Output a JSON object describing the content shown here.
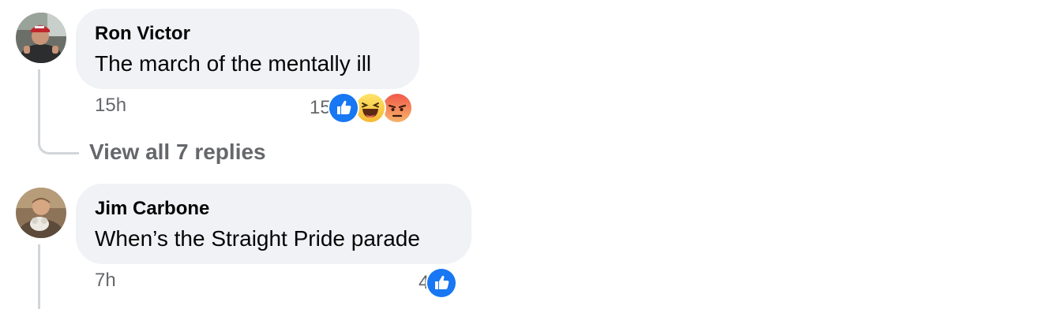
{
  "comments": [
    {
      "author": "Ron Victor",
      "text": "The march of the mentally ill",
      "time": "15h",
      "reaction_count": "15",
      "reactions": [
        "like-icon",
        "haha-icon",
        "angry-icon"
      ]
    },
    {
      "author": "Jim Carbone",
      "text": "When’s the Straight Pride parade",
      "time": "7h",
      "reaction_count": "4",
      "reactions": [
        "like-icon"
      ]
    }
  ],
  "replies": {
    "view_all_label": "View all 7 replies"
  },
  "colors": {
    "bubble_bg": "#f0f2f5",
    "meta_text": "#65676b",
    "like_blue": "#1877f2",
    "thread_line": "#d2d5da"
  }
}
